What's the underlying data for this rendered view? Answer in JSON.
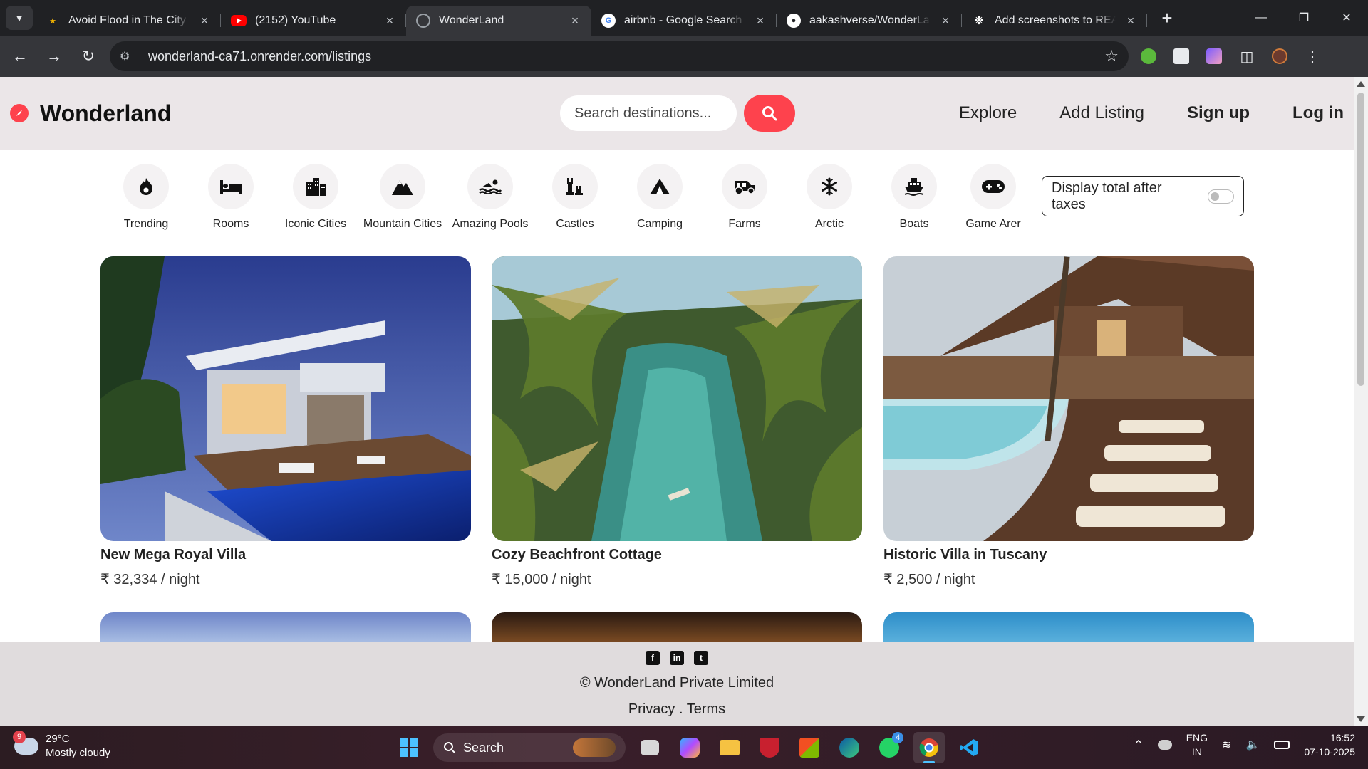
{
  "browser": {
    "tabs": [
      {
        "title": "Avoid Flood in The City - Lu",
        "icon": "flood-favicon",
        "color": "#f4b400",
        "active": false
      },
      {
        "title": "(2152) YouTube",
        "icon": "youtube-favicon",
        "color": "#ff0000",
        "active": false
      },
      {
        "title": "WonderLand",
        "icon": "globe-favicon",
        "color": "#9aa0a6",
        "active": true
      },
      {
        "title": "airbnb - Google Search",
        "icon": "google-favicon",
        "color": "#ffffff",
        "active": false
      },
      {
        "title": "aakashverse/WonderLand:",
        "icon": "github-favicon",
        "color": "#ffffff",
        "active": false
      },
      {
        "title": "Add screenshots to READM",
        "icon": "openai-favicon",
        "color": "#ffffff",
        "active": false
      }
    ],
    "url": "wonderland-ca71.onrender.com/listings"
  },
  "site": {
    "brand": "Wonderland",
    "search_placeholder": "Search destinations...",
    "nav": {
      "explore": "Explore",
      "add_listing": "Add Listing",
      "signup": "Sign up",
      "login": "Log in"
    }
  },
  "filters": [
    {
      "label": "Trending",
      "icon": "fire-icon"
    },
    {
      "label": "Rooms",
      "icon": "bed-icon"
    },
    {
      "label": "Iconic Cities",
      "icon": "city-icon"
    },
    {
      "label": "Mountain Cities",
      "icon": "mountain-icon"
    },
    {
      "label": "Amazing Pools",
      "icon": "swimmer-icon"
    },
    {
      "label": "Castles",
      "icon": "chess-rook-icon"
    },
    {
      "label": "Camping",
      "icon": "tent-icon"
    },
    {
      "label": "Farms",
      "icon": "tractor-icon"
    },
    {
      "label": "Arctic",
      "icon": "snowflake-icon"
    },
    {
      "label": "Boats",
      "icon": "ship-icon"
    },
    {
      "label": "Game Arer",
      "icon": "gamepad-icon"
    }
  ],
  "tax_toggle": {
    "label": "Display total after taxes",
    "on": false
  },
  "listings": [
    {
      "title": "New Mega Royal Villa",
      "price": "₹ 32,334 / night"
    },
    {
      "title": "Cozy Beachfront Cottage",
      "price": "₹ 15,000 / night"
    },
    {
      "title": "Historic Villa in Tuscany",
      "price": "₹ 2,500 / night"
    }
  ],
  "footer": {
    "socials": [
      "facebook-icon",
      "linkedin-icon",
      "twitter-icon"
    ],
    "copyright": "© WonderLand Private Limited",
    "links": "Privacy . Terms"
  },
  "taskbar": {
    "weather_badge": "9",
    "temperature": "29°C",
    "condition": "Mostly cloudy",
    "search_label": "Search",
    "whatsapp_badge": "4",
    "lang_top": "ENG",
    "lang_bottom": "IN",
    "time": "16:52",
    "date": "07-10-2025"
  },
  "colors": {
    "brand": "#fe424d",
    "header_bg": "#ebe6e8",
    "footer_bg": "#e0dcdd",
    "chrome_dark": "#202124",
    "chrome_mid": "#35363a"
  }
}
